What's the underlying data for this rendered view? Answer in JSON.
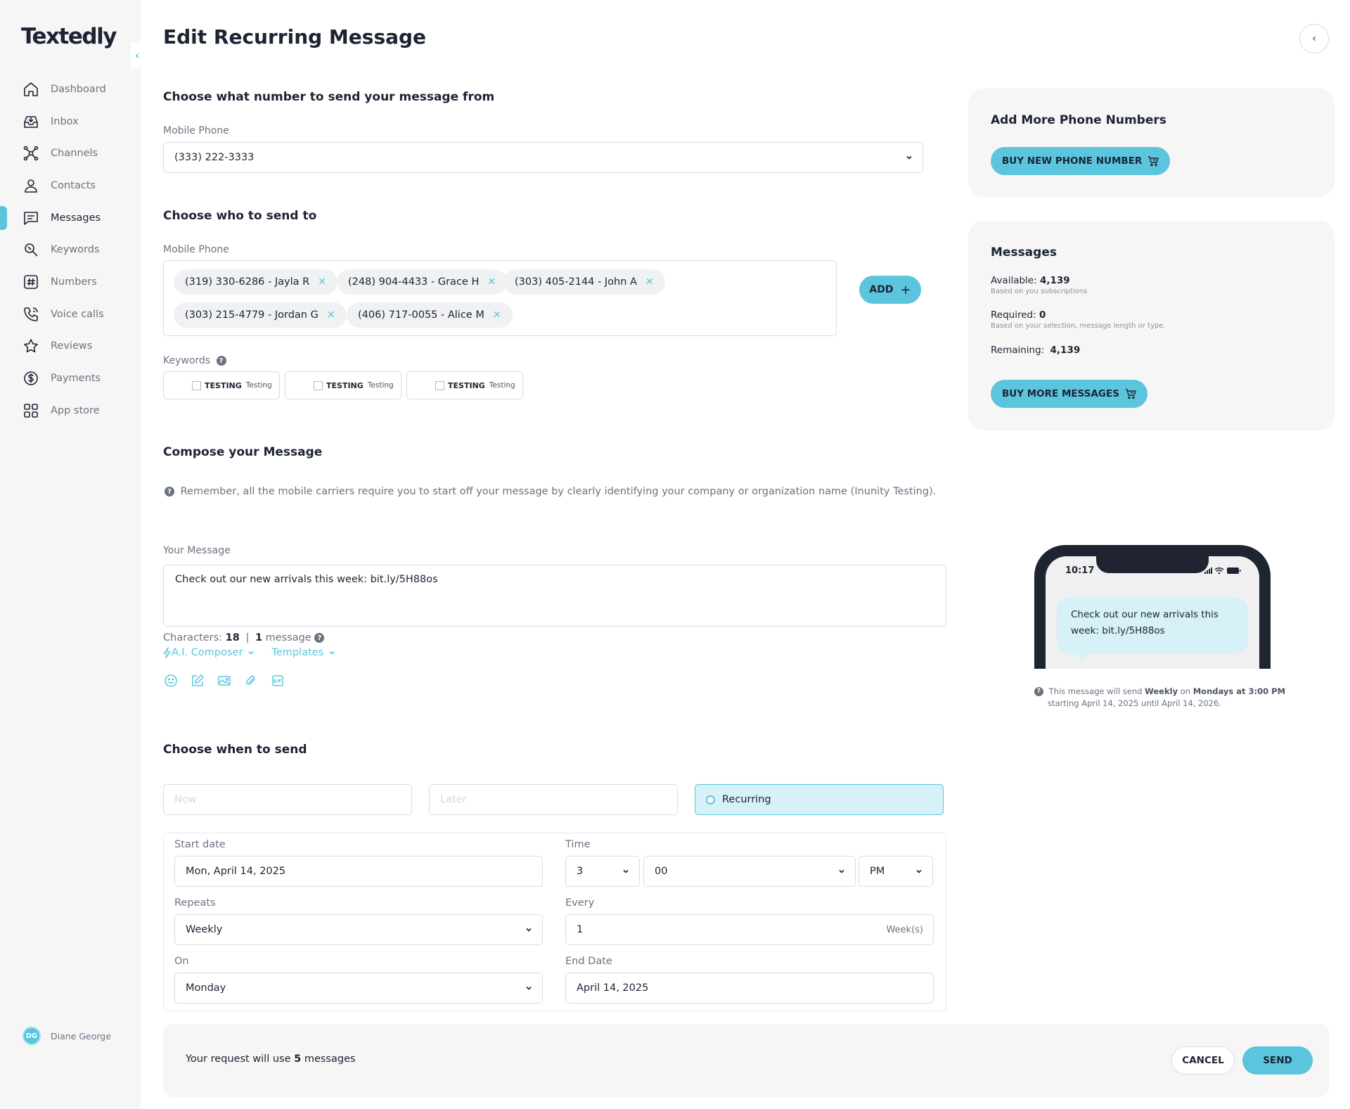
{
  "app": {
    "logo": "Textedly"
  },
  "sidebar": {
    "collapse_glyph": "‹",
    "items": [
      {
        "label": "Dashboard",
        "icon": "home-icon",
        "active": false
      },
      {
        "label": "Inbox",
        "icon": "inbox-icon",
        "active": false
      },
      {
        "label": "Channels",
        "icon": "channels-icon",
        "active": false
      },
      {
        "label": "Contacts",
        "icon": "contacts-icon",
        "active": false
      },
      {
        "label": "Messages",
        "icon": "messages-icon",
        "active": true
      },
      {
        "label": "Keywords",
        "icon": "keywords-icon",
        "active": false
      },
      {
        "label": "Numbers",
        "icon": "numbers-icon",
        "active": false
      },
      {
        "label": "Voice calls",
        "icon": "phone-icon",
        "active": false
      },
      {
        "label": "Reviews",
        "icon": "star-icon",
        "active": false
      },
      {
        "label": "Payments",
        "icon": "dollar-icon",
        "active": false
      },
      {
        "label": "App store",
        "icon": "app-store-icon",
        "active": false
      }
    ],
    "user": {
      "initials": "DG",
      "name": "Diane George"
    }
  },
  "header": {
    "title": "Edit Recurring Message",
    "collapse_glyph": "‹"
  },
  "from_section": {
    "heading": "Choose what number to send your message from",
    "label": "Mobile Phone",
    "value": "(333) 222-3333"
  },
  "to_section": {
    "heading": "Choose who to send to",
    "label": "Mobile Phone",
    "recipients": [
      "(319) 330-6286 - Jayla R",
      "(248) 904-4433 - Grace H",
      "(303) 405-2144 - John A",
      "(303) 215-4779 - Jordan G",
      "(406) 717-0055 - Alice M"
    ],
    "remove_glyph": "✕",
    "add_label": "ADD",
    "add_glyph": "+",
    "keywords_label": "Keywords",
    "help_glyph": "?",
    "keywords": [
      {
        "name": "TESTING",
        "desc": "Testing"
      },
      {
        "name": "TESTING",
        "desc": "Testing"
      },
      {
        "name": "TESTING",
        "desc": "Testing"
      }
    ]
  },
  "compose": {
    "heading": "Compose your Message",
    "notice": "Remember, all the mobile carriers require you to start off your message by clearly identifying your company or organization name (Inunity Testing).",
    "message_label": "Your Message",
    "message": "Check out our new arrivals this week: bit.ly/5H88os",
    "characters_label": "Characters:",
    "characters": "18",
    "separator": "|",
    "message_count": "1",
    "message_word": "message",
    "ai_composer": "A.I. Composer",
    "templates": "Templates"
  },
  "when": {
    "heading": "Choose when to send",
    "options": [
      {
        "label": "Now",
        "active": false
      },
      {
        "label": "Later",
        "active": false
      },
      {
        "label": "Recurring",
        "active": true
      }
    ],
    "start_date_label": "Start date",
    "start_date": "Mon, April 14, 2025",
    "time_label": "Time",
    "hour": "3",
    "minute": "00",
    "ampm": "PM",
    "repeats_label": "Repeats",
    "repeats": "Weekly",
    "every_label": "Every",
    "every": "1",
    "every_unit": "Week(s)",
    "on_label": "On",
    "on": "Monday",
    "end_date_label": "End Date",
    "end_date": "April 14, 2025"
  },
  "footer": {
    "prefix": "Your request will use",
    "count": "5",
    "suffix": "messages",
    "cancel": "CANCEL",
    "send": "SEND"
  },
  "phone_numbers_card": {
    "title": "Add More Phone Numbers",
    "button": "BUY NEW PHONE NUMBER"
  },
  "messages_card": {
    "title": "Messages",
    "available_label": "Available:",
    "available": "4,139",
    "available_sub": "Based on you subscriptions",
    "required_label": "Required:",
    "required": "0",
    "required_sub": "Based on your selection, message length or type.",
    "remaining_label": "Remaining:",
    "remaining": "4,139",
    "button": "BUY MORE MESSAGES"
  },
  "preview": {
    "time": "10:17",
    "bubble": "Check out our new arrivals this week: bit.ly/5H88os",
    "note_1": "This message will send",
    "note_freq": "Weekly",
    "note_on": "on",
    "note_when": "Mondays at 3:00 PM",
    "note_2": "starting April 14, 2025 until April 14, 2026."
  },
  "colors": {
    "accent": "#5bc5dd",
    "accent_light": "#d6f1f7",
    "text": "#1c2333",
    "muted": "#6b7280",
    "panel": "#f6f6f6"
  }
}
